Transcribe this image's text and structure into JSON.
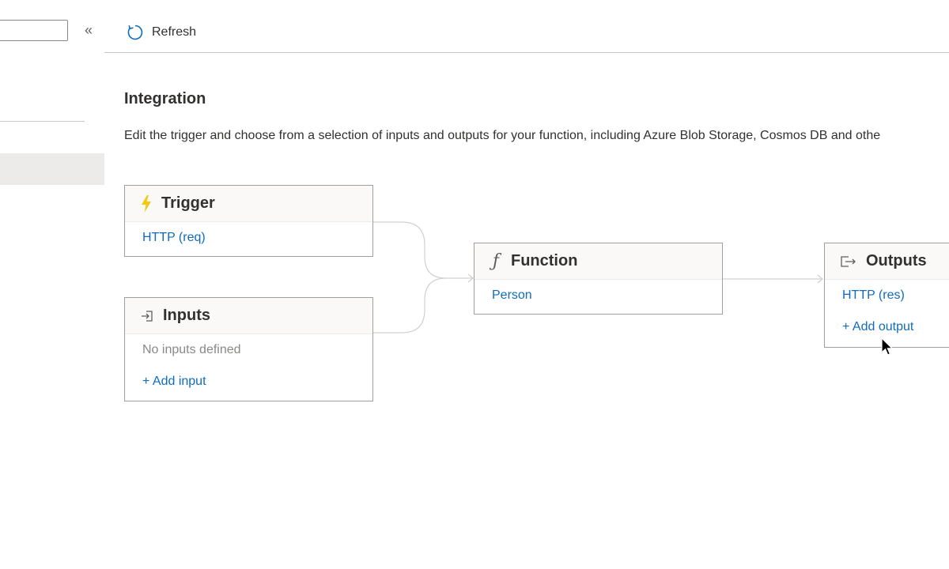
{
  "sidebar": {
    "search_value": "",
    "collapse_glyph": "«"
  },
  "toolbar": {
    "refresh_label": "Refresh",
    "refresh_icon": "refresh-icon"
  },
  "main": {
    "title": "Integration",
    "description": "Edit the trigger and choose from a selection of inputs and outputs for your function, including Azure Blob Storage, Cosmos DB and othe"
  },
  "trigger": {
    "title": "Trigger",
    "icon": "lightning-icon",
    "binding": "HTTP (req)"
  },
  "inputs": {
    "title": "Inputs",
    "icon": "input-icon",
    "empty_text": "No inputs defined",
    "add_label": "+ Add input"
  },
  "function": {
    "title": "Function",
    "icon": "function-icon",
    "name": "Person"
  },
  "outputs": {
    "title": "Outputs",
    "icon": "output-icon",
    "binding": "HTTP (res)",
    "add_label": "+ Add output"
  },
  "colors": {
    "link": "#0f6cbd",
    "trigger_icon": "#f2c811",
    "border": "#a19f9d"
  }
}
